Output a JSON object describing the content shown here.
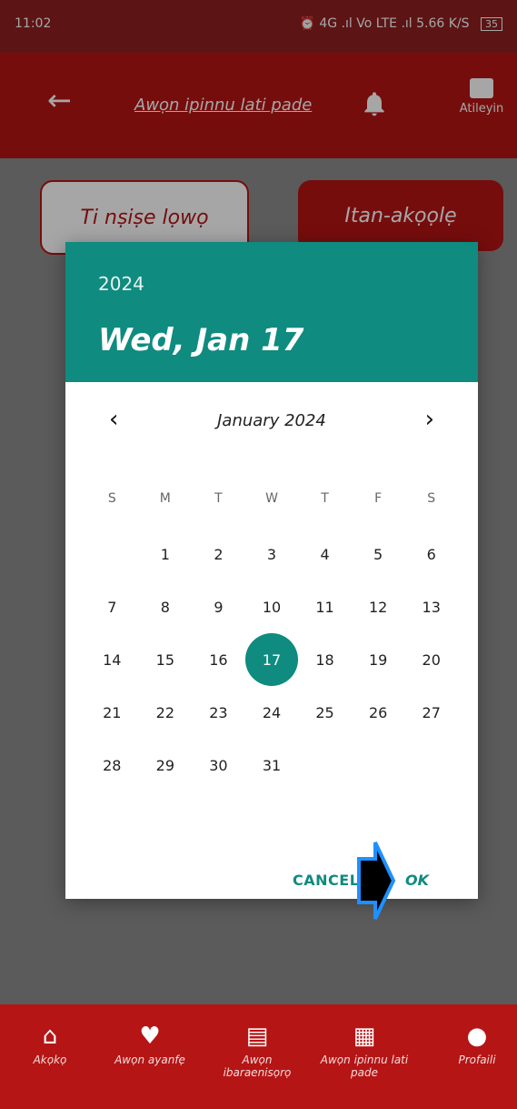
{
  "status_bar": {
    "time": "11:02",
    "right_icons": "⏰ 4G .ıl Vo LTE .ıl 5.66 K/S",
    "battery": "35"
  },
  "app_bar": {
    "title": "Awọn ipinnu lati pade",
    "messages_label": "Atileyin"
  },
  "tabs": {
    "left": "Ti nṣiṣe lọwọ",
    "right": "Itan-akọọlẹ"
  },
  "dialog": {
    "year": "2024",
    "date": "Wed, Jan 17",
    "month_label": "January 2024",
    "weekdays": [
      "S",
      "M",
      "T",
      "W",
      "T",
      "F",
      "S"
    ],
    "days": [
      "",
      "1",
      "2",
      "3",
      "4",
      "5",
      "6",
      "7",
      "8",
      "9",
      "10",
      "11",
      "12",
      "13",
      "14",
      "15",
      "16",
      "17",
      "18",
      "19",
      "20",
      "21",
      "22",
      "23",
      "24",
      "25",
      "26",
      "27",
      "28",
      "29",
      "30",
      "31",
      "",
      "",
      ""
    ],
    "selected_day": "17",
    "cancel": "CANCEL",
    "ok": "OK",
    "accent": "#0f8b7f"
  },
  "bottom_nav": [
    {
      "label": "Akọkọ",
      "icon": "home-icon"
    },
    {
      "label": "Awọn ayanfẹ",
      "icon": "heart-icon"
    },
    {
      "label": "Awọn ibaraenisọrọ",
      "icon": "chat-icon"
    },
    {
      "label": "Awọn ipinnu lati pade",
      "icon": "calendar-icon"
    },
    {
      "label": "Profaili",
      "icon": "profile-icon"
    }
  ],
  "colors": {
    "brand": "#b51515",
    "status_bar": "#8f1f1f"
  }
}
